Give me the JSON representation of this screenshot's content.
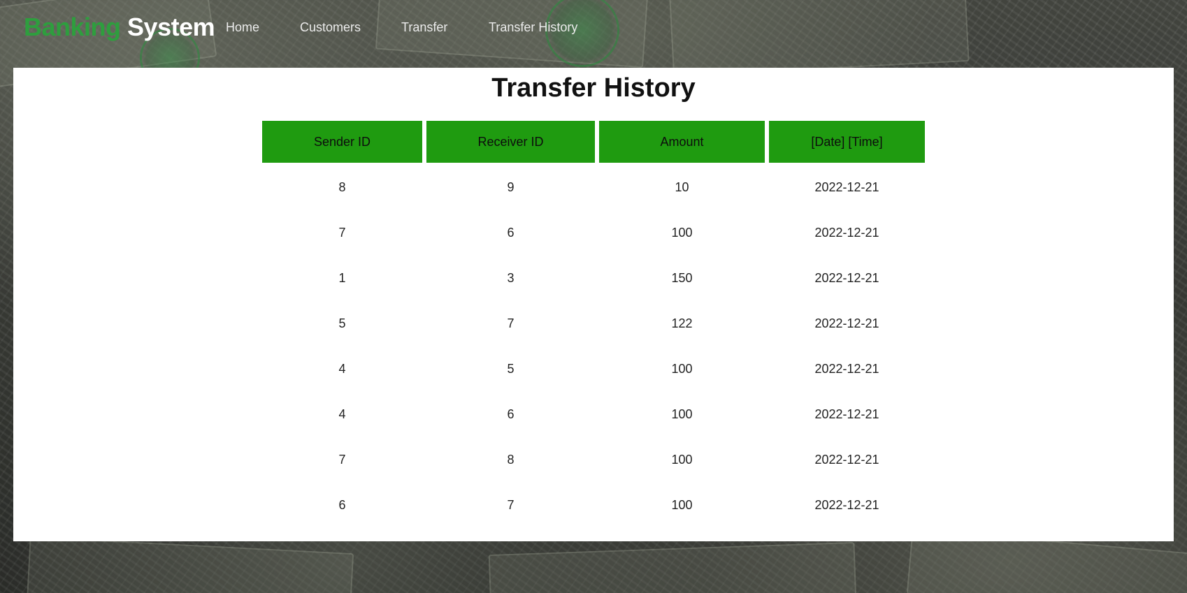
{
  "brand": {
    "part1": "Banking",
    "part2": "System"
  },
  "nav": [
    {
      "label": "Home"
    },
    {
      "label": "Customers"
    },
    {
      "label": "Transfer"
    },
    {
      "label": "Transfer History"
    }
  ],
  "page_title": "Transfer History",
  "table": {
    "columns": [
      "Sender ID",
      "Receiver ID",
      "Amount",
      "[Date] [Time]"
    ],
    "rows": [
      [
        "8",
        "9",
        "10",
        "2022-12-21"
      ],
      [
        "7",
        "6",
        "100",
        "2022-12-21"
      ],
      [
        "1",
        "3",
        "150",
        "2022-12-21"
      ],
      [
        "5",
        "7",
        "122",
        "2022-12-21"
      ],
      [
        "4",
        "5",
        "100",
        "2022-12-21"
      ],
      [
        "4",
        "6",
        "100",
        "2022-12-21"
      ],
      [
        "7",
        "8",
        "100",
        "2022-12-21"
      ],
      [
        "6",
        "7",
        "100",
        "2022-12-21"
      ]
    ]
  },
  "colors": {
    "brand_green": "#2e9e3e",
    "header_green": "#1f9b10",
    "panel_bg": "#ffffff"
  }
}
